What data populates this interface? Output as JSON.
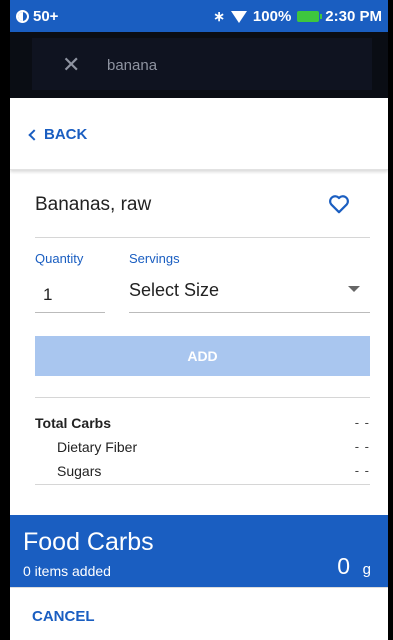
{
  "status_bar": {
    "notification": "50+",
    "battery_percent": "100%",
    "time": "2:30 PM"
  },
  "search": {
    "query": "banana"
  },
  "nav": {
    "back_label": "BACK"
  },
  "food": {
    "name": "Bananas, raw",
    "quantity_label": "Quantity",
    "quantity_value": "1",
    "servings_label": "Servings",
    "servings_value": "Select Size",
    "add_label": "ADD"
  },
  "nutrients": [
    {
      "label": "Total Carbs",
      "value": "- -"
    },
    {
      "label": "Dietary Fiber",
      "value": "- -"
    },
    {
      "label": "Sugars",
      "value": "- -"
    }
  ],
  "summary": {
    "title": "Food Carbs",
    "subtitle": "0 items added",
    "value": "0",
    "unit": "g"
  },
  "footer": {
    "cancel_label": "CANCEL"
  },
  "colors": {
    "primary": "#1a5ec1",
    "add_disabled": "#a9c6ef",
    "battery": "#3ec63e"
  }
}
